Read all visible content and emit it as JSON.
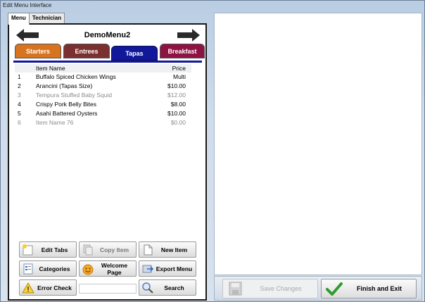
{
  "window": {
    "title": "Edit Menu Interface"
  },
  "tabs": [
    {
      "label": "Menu",
      "active": true
    },
    {
      "label": "Technician",
      "active": false
    }
  ],
  "menu": {
    "name": "DemoMenu2"
  },
  "categories": [
    {
      "label": "Starters",
      "color": "#d8741f"
    },
    {
      "label": "Entrees",
      "color": "#7b2f2f"
    },
    {
      "label": "Tapas",
      "color": "#12189a",
      "selected": true
    },
    {
      "label": "Breakfast",
      "color": "#8f1342"
    }
  ],
  "items_table": {
    "columns": [
      "Item Name",
      "Price"
    ],
    "rows": [
      {
        "num": "1",
        "name": "Buffalo Spiced Chicken Wings",
        "price": "Multi",
        "active": true
      },
      {
        "num": "2",
        "name": "Arancini (Tapas Size)",
        "price": "$10.00",
        "active": true
      },
      {
        "num": "3",
        "name": "Tempura Stuffed Baby Squid",
        "price": "$12.00",
        "active": false
      },
      {
        "num": "4",
        "name": "Crispy Pork Belly Bites",
        "price": "$8.00",
        "active": true
      },
      {
        "num": "5",
        "name": "Asahi Battered Oysters",
        "price": "$10.00",
        "active": true
      },
      {
        "num": "6",
        "name": "Item Name 76",
        "price": "$0.00",
        "active": false
      }
    ]
  },
  "buttons": {
    "edit_tabs": "Edit Tabs",
    "copy_item": "Copy Item",
    "new_item": "New Item",
    "categories": "Categories",
    "welcome_page": "Welcome Page",
    "export_menu": "Export Menu",
    "error_check": "Error Check",
    "search": "Search",
    "save_changes": "Save Changes",
    "finish_exit": "Finish and Exit"
  },
  "search_field": {
    "value": ""
  }
}
